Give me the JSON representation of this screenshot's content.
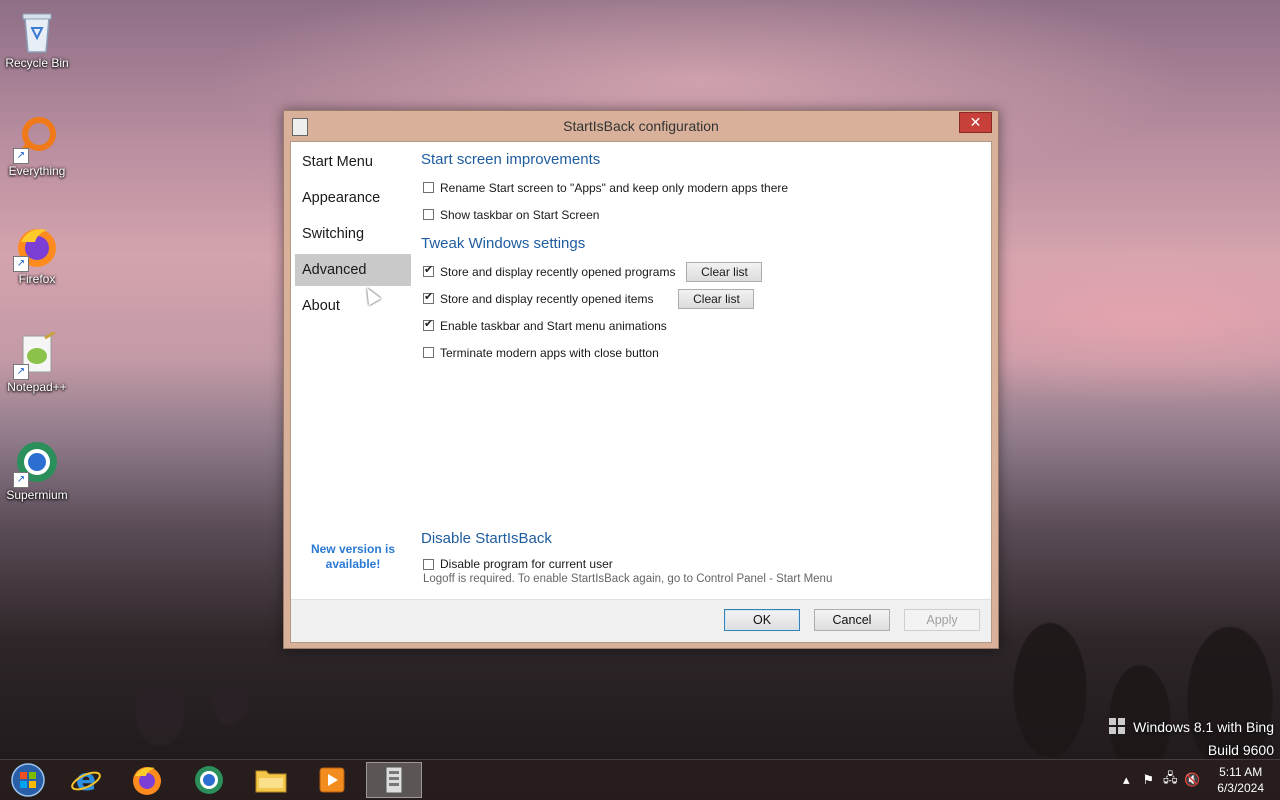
{
  "desktop": {
    "icons": [
      {
        "label": "Recycle Bin"
      },
      {
        "label": "Everything"
      },
      {
        "label": "Firefox"
      },
      {
        "label": "Notepad++"
      },
      {
        "label": "Supermium"
      }
    ]
  },
  "window": {
    "title": "StartIsBack configuration",
    "close_glyph": "✕",
    "nav": {
      "items": [
        "Start Menu",
        "Appearance",
        "Switching",
        "Advanced",
        "About"
      ],
      "active": "Advanced"
    },
    "new_version": "New version is available!",
    "sections": {
      "start_screen": {
        "title": "Start screen improvements",
        "rename_option": "Rename Start screen to \"Apps\" and keep only modern apps there",
        "show_taskbar_option": "Show taskbar on Start Screen"
      },
      "tweak": {
        "title": "Tweak Windows settings",
        "recent_programs_option": "Store and display recently opened programs",
        "recent_items_option": "Store and display recently opened items",
        "animations_option": "Enable taskbar and Start menu animations",
        "terminate_option": "Terminate modern apps with close button",
        "clear_list_label": "Clear list"
      },
      "disable": {
        "title": "Disable StartIsBack",
        "option": "Disable program for current user",
        "note": "Logoff is required. To enable StartIsBack again, go to Control Panel - Start Menu"
      }
    },
    "checkbox_states": {
      "rename": false,
      "show_taskbar": false,
      "recent_programs": true,
      "recent_items": true,
      "animations": true,
      "terminate": false,
      "disable": false
    },
    "buttons": {
      "ok": "OK",
      "cancel": "Cancel",
      "apply": "Apply"
    }
  },
  "watermark": {
    "line1": "Windows 8.1 with Bing",
    "line2": "Build 9600"
  },
  "taskbar": {
    "pinned": [
      "start-orb",
      "internet-explorer",
      "firefox",
      "supermium",
      "file-explorer",
      "media-player",
      "startisback-config"
    ],
    "clock": {
      "time": "5:11 AM",
      "date": "6/3/2024"
    }
  },
  "colors": {
    "accent": "#1f5c9e",
    "link": "#2a7ad4",
    "close": "#c7413a"
  }
}
